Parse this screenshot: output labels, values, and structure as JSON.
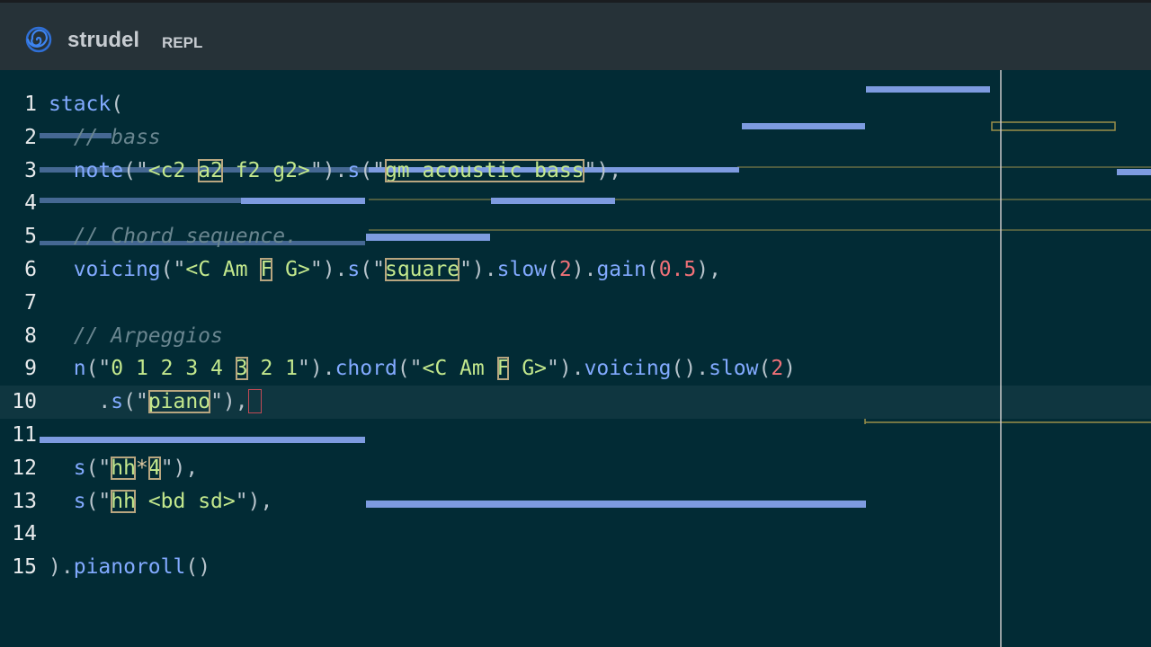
{
  "header": {
    "app_name": "strudel",
    "app_subtitle": "REPL",
    "logo_icon": "spiral-logo-icon"
  },
  "colors": {
    "background": "#022b35",
    "header": "#263238",
    "function": "#82aaff",
    "string": "#c3e88d",
    "number": "#f07178",
    "comment": "#6a8690",
    "pianoroll_note": "#7d9be0",
    "pianoroll_outline": "#9a8f4a",
    "playhead": "#c8c8c8"
  },
  "editor": {
    "lines": [
      {
        "n": "1",
        "tokens": [
          [
            "stack",
            "fn"
          ],
          [
            "(",
            "pu"
          ]
        ]
      },
      {
        "n": "2",
        "tokens": [
          [
            "  ",
            "pu"
          ],
          [
            "// bass",
            "cm"
          ]
        ]
      },
      {
        "n": "3",
        "tokens": [
          [
            "  ",
            "pu"
          ],
          [
            "note",
            "fn"
          ],
          [
            "(\"",
            "pu"
          ],
          [
            "<c2 ",
            "st"
          ],
          [
            "a2",
            "st",
            "hl"
          ],
          [
            " f2 g2>",
            "st"
          ],
          [
            "\"",
            "pu"
          ],
          [
            ").",
            "pu"
          ],
          [
            "s",
            "fn"
          ],
          [
            "(\"",
            "pu"
          ],
          [
            "gm_acoustic_bass",
            "st",
            "hl"
          ],
          [
            "\"",
            "pu"
          ],
          [
            "),",
            "pu"
          ]
        ]
      },
      {
        "n": "4",
        "tokens": []
      },
      {
        "n": "5",
        "tokens": [
          [
            "  ",
            "pu"
          ],
          [
            "// Chord sequence.",
            "cm"
          ]
        ]
      },
      {
        "n": "6",
        "tokens": [
          [
            "  ",
            "pu"
          ],
          [
            "voicing",
            "fn"
          ],
          [
            "(\"",
            "pu"
          ],
          [
            "<C Am ",
            "st"
          ],
          [
            "F",
            "st",
            "hl"
          ],
          [
            " G>",
            "st"
          ],
          [
            "\"",
            "pu"
          ],
          [
            ").",
            "pu"
          ],
          [
            "s",
            "fn"
          ],
          [
            "(\"",
            "pu"
          ],
          [
            "square",
            "st",
            "hl"
          ],
          [
            "\"",
            "pu"
          ],
          [
            ").",
            "pu"
          ],
          [
            "slow",
            "fn"
          ],
          [
            "(",
            "pu"
          ],
          [
            "2",
            "nu"
          ],
          [
            ").",
            "pu"
          ],
          [
            "gain",
            "fn"
          ],
          [
            "(",
            "pu"
          ],
          [
            "0.5",
            "nu"
          ],
          [
            "),",
            "pu"
          ]
        ]
      },
      {
        "n": "7",
        "tokens": []
      },
      {
        "n": "8",
        "tokens": [
          [
            "  ",
            "pu"
          ],
          [
            "// Arpeggios",
            "cm"
          ]
        ]
      },
      {
        "n": "9",
        "tokens": [
          [
            "  ",
            "pu"
          ],
          [
            "n",
            "fn"
          ],
          [
            "(\"",
            "pu"
          ],
          [
            "0 1 2 3 4 ",
            "st"
          ],
          [
            "3",
            "st",
            "hl"
          ],
          [
            " 2 1",
            "st"
          ],
          [
            "\"",
            "pu"
          ],
          [
            ").",
            "pu"
          ],
          [
            "chord",
            "fn"
          ],
          [
            "(\"",
            "pu"
          ],
          [
            "<C Am ",
            "st"
          ],
          [
            "F",
            "st",
            "hl"
          ],
          [
            " G>",
            "st"
          ],
          [
            "\"",
            "pu"
          ],
          [
            ").",
            "pu"
          ],
          [
            "voicing",
            "fn"
          ],
          [
            "().",
            "pu"
          ],
          [
            "slow",
            "fn"
          ],
          [
            "(",
            "pu"
          ],
          [
            "2",
            "nu"
          ],
          [
            ")",
            "pu"
          ]
        ]
      },
      {
        "n": "10",
        "active": true,
        "cursor": true,
        "tokens": [
          [
            "    .",
            "pu"
          ],
          [
            "s",
            "fn"
          ],
          [
            "(\"",
            "pu"
          ],
          [
            "piano",
            "st",
            "hl"
          ],
          [
            "\"",
            "pu"
          ],
          [
            "),",
            "pu"
          ]
        ]
      },
      {
        "n": "11",
        "tokens": []
      },
      {
        "n": "12",
        "tokens": [
          [
            "  ",
            "pu"
          ],
          [
            "s",
            "fn"
          ],
          [
            "(\"",
            "pu"
          ],
          [
            "hh",
            "st",
            "hl"
          ],
          [
            "*",
            "sy"
          ],
          [
            "4",
            "st",
            "hl"
          ],
          [
            "\"",
            "pu"
          ],
          [
            "),",
            "pu"
          ]
        ]
      },
      {
        "n": "13",
        "tokens": [
          [
            "  ",
            "pu"
          ],
          [
            "s",
            "fn"
          ],
          [
            "(\"",
            "pu"
          ],
          [
            "hh",
            "st",
            "hl"
          ],
          [
            " <bd sd>",
            "st"
          ],
          [
            "\"",
            "pu"
          ],
          [
            "),",
            "pu"
          ]
        ]
      },
      {
        "n": "14",
        "tokens": []
      },
      {
        "n": "15",
        "tokens": [
          [
            ")",
            "pu"
          ],
          [
            ".",
            "pu"
          ],
          [
            "pianoroll",
            "fn"
          ],
          [
            "()",
            "pu"
          ]
        ]
      }
    ]
  }
}
